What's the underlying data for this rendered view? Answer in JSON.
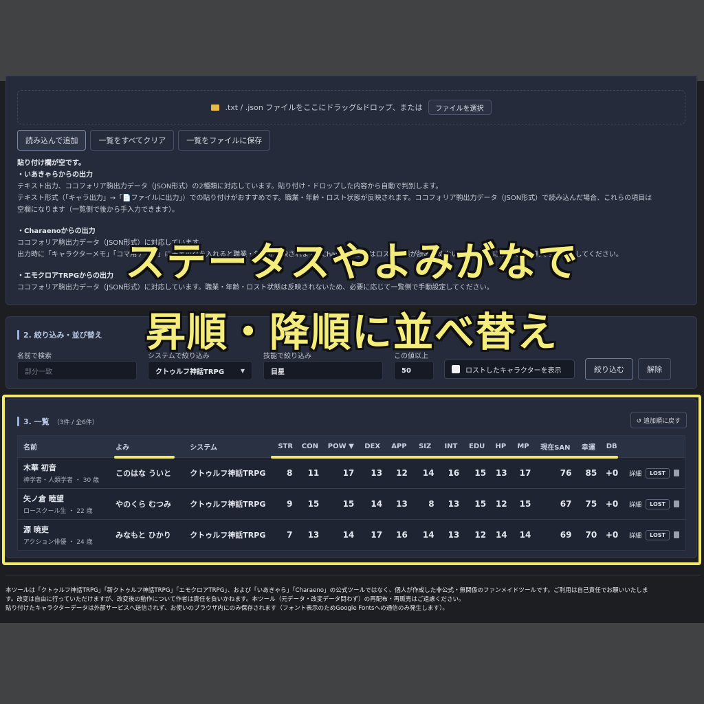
{
  "input_section": {
    "dropzone_text": ".txt / .json ファイルをここにドラッグ&ドロップ、または",
    "file_button": "ファイルを選択",
    "buttons": [
      "読み込んで追加",
      "一覧をすべてクリア",
      "一覧をファイルに保存"
    ],
    "status": "貼り付け欄が空です。",
    "info": {
      "iakyara_title": "・いあきゃらからの出力",
      "iakyara_line1": "テキスト出力、ココフォリア駒出力データ（JSON形式）の2種類に対応しています。貼り付け・ドロップした内容から自動で判別します。",
      "iakyara_line2": "テキスト形式（「キャラ出力」→「📄ファイルに出力」）での貼り付けがおすすめです。職業・年齢・ロスト状態が反映されます。ココフォリア駒出力データ（JSON形式）で読み込んだ場合、これらの項目は",
      "iakyara_line3": "空欄になります（一覧側で後から手入力できます）。",
      "charaeno_title": "・Charaenoからの出力",
      "charaeno_line1": "ココフォリア駒出力データ（JSON形式）に対応しています。",
      "charaeno_line2": "出力時に「キャラクターメモ」「コマ用データ」にチェックを入れると職業・年齢が反映されます。Charaenoからはロスト状態が読み込めないため、必要に応じて一覧側で手動設定してください。",
      "emoklore_title": "・エモクロアTRPGからの出力",
      "emoklore_line1": "ココフォリア駒出力データ（JSON形式）に対応しています。職業・年齢・ロスト状態は反映されないため、必要に応じて一覧側で手動設定してください。"
    }
  },
  "filter_section": {
    "title": "2. 絞り込み・並び替え",
    "name_label": "名前で検索",
    "name_placeholder": "部分一致",
    "system_label": "システムで絞り込み",
    "system_value": "クトゥルフ神話TRPG",
    "skill_label": "技能で絞り込み",
    "skill_value": "目星",
    "min_label": "この値以上",
    "min_value": "50",
    "lost_checkbox": "ロストしたキャラクターを表示",
    "apply_button": "絞り込む",
    "clear_button": "解除"
  },
  "list_section": {
    "title": "3. 一覧",
    "count": "（3件 / 全6件）",
    "reset_button": "↺ 追加順に戻す",
    "columns": [
      "名前",
      "よみ",
      "システム",
      "STR",
      "CON",
      "POW ▼",
      "DEX",
      "APP",
      "SIZ",
      "INT",
      "EDU",
      "HP",
      "MP",
      "現在SAN",
      "幸運",
      "DB"
    ],
    "rows": [
      {
        "name": "木華 初音",
        "meta": "神学者・人類学者 ・ 30 歳",
        "reading": "このはな ういと",
        "system": "クトゥルフ神話TRPG",
        "stats": [
          "8",
          "11",
          "17",
          "13",
          "12",
          "14",
          "16",
          "15",
          "13",
          "17",
          "76",
          "85",
          "+0"
        ],
        "detail": "詳細",
        "lost": "LOST"
      },
      {
        "name": "矢ノ倉 睦望",
        "meta": "ロースクール生 ・ 22 歳",
        "reading": "やのくら むつみ",
        "system": "クトゥルフ神話TRPG",
        "stats": [
          "9",
          "15",
          "15",
          "14",
          "13",
          "8",
          "13",
          "15",
          "12",
          "15",
          "67",
          "75",
          "+0"
        ],
        "detail": "詳細",
        "lost": "LOST"
      },
      {
        "name": "源 暁吏",
        "meta": "アクション俳優 ・ 24 歳",
        "reading": "みなもと ひかり",
        "system": "クトゥルフ神話TRPG",
        "stats": [
          "7",
          "13",
          "14",
          "17",
          "16",
          "14",
          "13",
          "12",
          "14",
          "14",
          "69",
          "70",
          "+0"
        ],
        "detail": "詳細",
        "lost": "LOST"
      }
    ]
  },
  "footer": {
    "line1": "本ツールは「クトゥルフ神話TRPG」「新クトゥルフ神話TRPG」「エモクロアTRPG」、および「いあきゃら」「Charaeno」の公式ツールではなく、個人が作成した非公式・無関係のファンメイドツールです。ご利用は自己責任でお願いいたしま",
    "line2": "す。改変は自由に行っていただけますが、改変後の動作について作者は責任を負いかねます。本ツール（元データ・改変データ問わず）の再配布・再販売はご遠慮ください。",
    "line3": "貼り付けたキャラクターデータは外部サービスへ送信されず、お使いのブラウザ内にのみ保存されます（フォント表示のためGoogle Fontsへの通信のみ発生します）。"
  },
  "overlay": {
    "line1": "ステータスやよみがなで",
    "line2": "昇順・降順に並べ替え"
  },
  "colors": {
    "highlight": "#f1e96c",
    "accent": "#8fb6ea",
    "panel": "#252b3a"
  }
}
